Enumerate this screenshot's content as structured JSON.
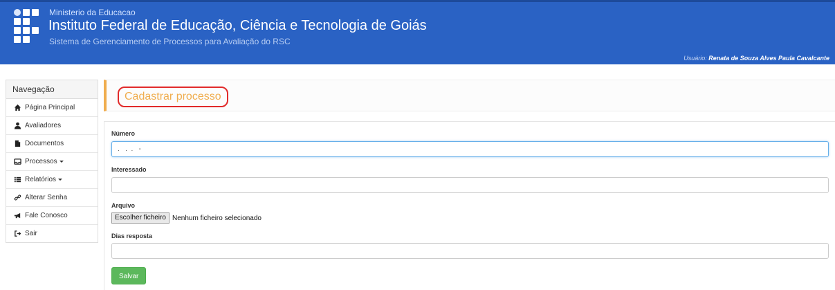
{
  "header": {
    "ministry": "Ministerio da Educacao",
    "institute": "Instituto Federal de Educação, Ciência e Tecnologia de Goiás",
    "system": "Sistema de Gerenciamento de Processos para Avaliação do RSC",
    "user_label": "Usuário:",
    "user_name": "Renata de Souza Alves Paula Cavalcante",
    "bg_color": "#2a62c4"
  },
  "sidebar": {
    "title": "Navegação",
    "items": [
      {
        "label": "Página Principal",
        "icon": "home-icon"
      },
      {
        "label": "Avaliadores",
        "icon": "user-icon"
      },
      {
        "label": "Documentos",
        "icon": "file-icon"
      },
      {
        "label": "Processos",
        "icon": "inbox-icon"
      },
      {
        "label": "Relatórios",
        "icon": "list-icon"
      },
      {
        "label": "Alterar Senha",
        "icon": "link-icon"
      },
      {
        "label": "Fale Conosco",
        "icon": "megaphone-icon"
      },
      {
        "label": "Sair",
        "icon": "logout-icon"
      }
    ]
  },
  "page": {
    "title": "Cadastrar processo",
    "accent_color": "#f0ad4e"
  },
  "form": {
    "numero_label": "Número",
    "numero_value": ".   .  .   -",
    "interessado_label": "Interessado",
    "interessado_value": "",
    "arquivo_label": "Arquivo",
    "file_button": "Escolher ficheiro",
    "file_status": "Nenhum ficheiro selecionado",
    "dias_label": "Dias resposta",
    "dias_value": "",
    "save_label": "Salvar",
    "save_color": "#5cb85c"
  }
}
